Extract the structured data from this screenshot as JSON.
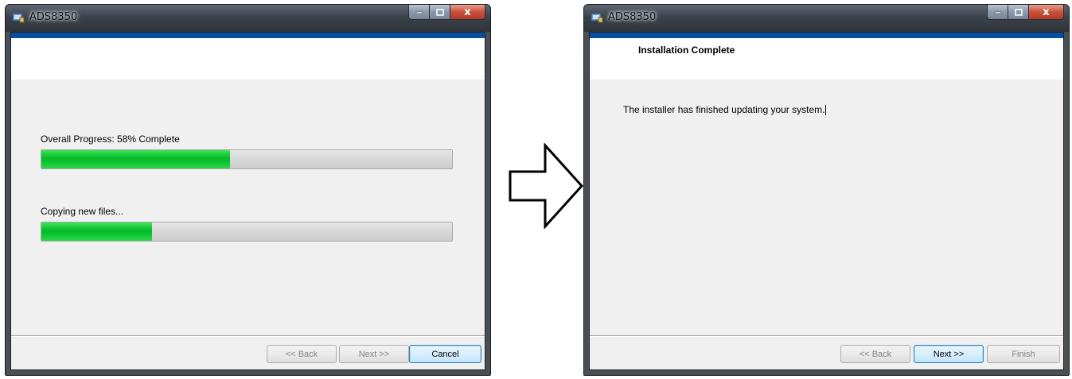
{
  "left_window": {
    "title": "ADS8350",
    "overall_progress_label": "Overall Progress: 58% Complete",
    "overall_progress_value": 0.46,
    "copying_label": "Copying new files...",
    "copying_progress_value": 0.27,
    "buttons": {
      "back": "<< Back",
      "next": "Next >>",
      "cancel": "Cancel"
    },
    "close_glyph": "x"
  },
  "right_window": {
    "title": "ADS8350",
    "header": "Installation Complete",
    "message": "The installer has finished updating your system.",
    "buttons": {
      "back": "<< Back",
      "next": "Next >>",
      "finish": "Finish"
    },
    "close_glyph": "x"
  },
  "arrow_icon": "right-arrow-outline",
  "colors": {
    "banner_strip": "#05519f",
    "progress_fill": "#07b829",
    "close_button": "#c9513b"
  }
}
